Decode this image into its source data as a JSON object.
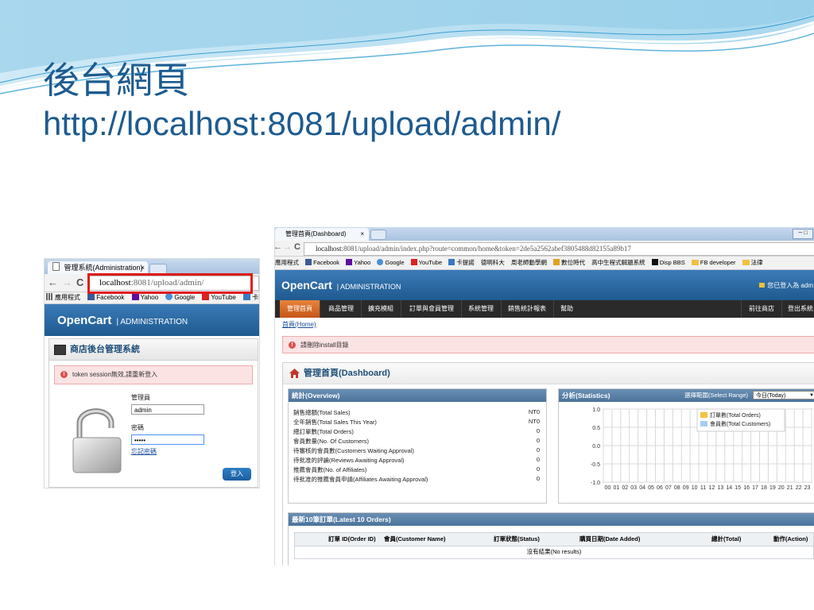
{
  "slide": {
    "title_line1": "後台網頁",
    "title_line2": "http://localhost:8081/upload/admin/"
  },
  "colors": {
    "title": "#1d5b8f",
    "opencart_header": "#2a6aa5",
    "menu_active": "#d9692a",
    "highlight_box": "#e21a1a",
    "alert_bg": "#fbe3e4"
  },
  "login_window": {
    "tab_title": "管理系統(Administration)",
    "tab_close": "×",
    "nav_back": "←",
    "nav_forward": "→",
    "nav_reload": "C",
    "url_host": "localhost",
    "url_rest": ":8081/upload/admin/",
    "bookmarks": [
      {
        "label": "應用程式",
        "icon": "apps-icon"
      },
      {
        "label": "Facebook",
        "icon": "facebook-icon"
      },
      {
        "label": "Yahoo",
        "icon": "yahoo-icon"
      },
      {
        "label": "Google",
        "icon": "google-icon"
      },
      {
        "label": "YouTube",
        "icon": "youtube-icon"
      },
      {
        "label": "卡提",
        "icon": "bookmark-icon"
      }
    ],
    "brand": "OpenCart",
    "brand_sub": "ADMINISTRATION",
    "panel_title": "商店後台管理系統",
    "alert": "token session無效,請重新登入",
    "username_label": "管理員",
    "username_value": "admin",
    "password_label": "密碼",
    "password_value": "•••••",
    "forgot_link": "忘記密碼",
    "login_button": "登入"
  },
  "dashboard_window": {
    "tab_title": "管理首頁(Dashboard)",
    "tab_close": "×",
    "win_controls": "─ □",
    "nav_back": "←",
    "nav_forward": "→",
    "nav_reload": "C",
    "url_host": "localhost",
    "url_rest": ":8081/upload/admin/index.php?route=common/home&token=2de5a2562abef3805488d82155a89b17",
    "bookmarks": [
      "應用程式",
      "Facebook",
      "Yahoo",
      "Google",
      "YouTube",
      "卡提諾",
      "德明科大",
      "周老師動學網",
      "數位時代",
      "高中生程式解題系統",
      "Disp BBS",
      "FB developer",
      "法律"
    ],
    "brand": "OpenCart",
    "brand_sub": "ADMINISTRATION",
    "logged_in": "您已登入為 adm",
    "menu": [
      "管理首頁",
      "商品管理",
      "擴充模組",
      "訂單與會員管理",
      "系統管理",
      "銷售統計報表",
      "幫助"
    ],
    "menu_right": [
      "前往商店",
      "登出系統"
    ],
    "breadcrumb": "首頁(Home)",
    "alert": "請刪除install目錄",
    "dashboard_title": "管理首頁(Dashboard)",
    "overview": {
      "title": "統計(Overview)",
      "rows": [
        {
          "label": "銷售總額(Total Sales)",
          "value": "NT0"
        },
        {
          "label": "全年銷售(Total Sales This Year)",
          "value": "NT0"
        },
        {
          "label": "總訂單數(Total Orders)",
          "value": "0"
        },
        {
          "label": "會員數量(No. Of Customers)",
          "value": "0"
        },
        {
          "label": "待審核的會員數(Customers Waiting Approval)",
          "value": "0"
        },
        {
          "label": "待批准的評論(Reviews Awaiting Approval)",
          "value": "0"
        },
        {
          "label": "推薦會員數(No. of Affiliates)",
          "value": "0"
        },
        {
          "label": "待批准的推薦會員申請(Affiliates Awaiting Approval)",
          "value": "0"
        }
      ]
    },
    "statistics": {
      "title": "分析(Statistics)",
      "range_label": "選擇範圍(Select Range)",
      "range_value": "今日(Today)"
    },
    "latest_orders": {
      "title": "最新10筆訂單(Latest 10 Orders)",
      "columns": [
        "訂單 ID(Order ID)",
        "會員(Customer Name)",
        "訂單狀態(Status)",
        "購買日期(Date Added)",
        "總計(Total)",
        "動作(Action)"
      ],
      "empty": "沒有結果(No results)"
    }
  },
  "chart_data": {
    "type": "line",
    "x": [
      "00",
      "01",
      "02",
      "03",
      "04",
      "05",
      "06",
      "07",
      "08",
      "09",
      "10",
      "11",
      "12",
      "13",
      "14",
      "15",
      "16",
      "17",
      "18",
      "19",
      "20",
      "21",
      "22",
      "23"
    ],
    "series": [
      {
        "name": "訂單數(Total Orders)",
        "color": "#f5c242",
        "values": []
      },
      {
        "name": "會員數(Total Customers)",
        "color": "#a9cdf0",
        "values": []
      }
    ],
    "yticks": [
      "1.0",
      "0.5",
      "0.0",
      "-0.5",
      "-1.0"
    ],
    "ylim": [
      -1.0,
      1.0
    ],
    "grid": true,
    "legend": "top-right"
  }
}
